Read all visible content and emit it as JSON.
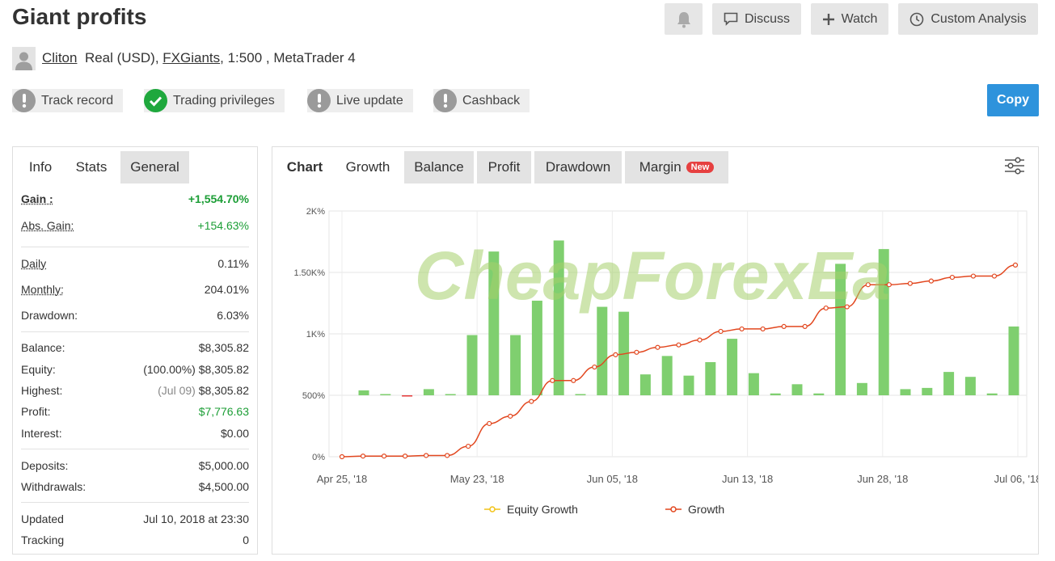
{
  "page": {
    "title": "Giant profits"
  },
  "header_buttons": {
    "discuss": "Discuss",
    "watch": "Watch",
    "custom_analysis": "Custom Analysis"
  },
  "owner": {
    "name": "Cliton",
    "account_type": "Real (USD),",
    "broker": "FXGiants",
    "details": ", 1:500 , MetaTrader 4"
  },
  "badges": [
    {
      "label": "Track record",
      "status": "grey"
    },
    {
      "label": "Trading privileges",
      "status": "green"
    },
    {
      "label": "Live update",
      "status": "grey"
    },
    {
      "label": "Cashback",
      "status": "grey"
    }
  ],
  "copy_label": "Copy",
  "left_tabs": [
    "Info",
    "Stats",
    "General"
  ],
  "stats": {
    "gain_label": "Gain :",
    "gain_value": "+1,554.70%",
    "abs_gain_label": "Abs. Gain:",
    "abs_gain_value": "+154.63%",
    "daily_label": "Daily",
    "daily_value": "0.11%",
    "monthly_label": "Monthly:",
    "monthly_value": "204.01%",
    "drawdown_label": "Drawdown:",
    "drawdown_value": "6.03%",
    "balance_label": "Balance:",
    "balance_value": "$8,305.82",
    "equity_label": "Equity:",
    "equity_pct": "(100.00%)",
    "equity_value": "$8,305.82",
    "highest_label": "Highest:",
    "highest_date": "(Jul 09)",
    "highest_value": "$8,305.82",
    "profit_label": "Profit:",
    "profit_value": "$7,776.63",
    "interest_label": "Interest:",
    "interest_value": "$0.00",
    "deposits_label": "Deposits:",
    "deposits_value": "$5,000.00",
    "withdrawals_label": "Withdrawals:",
    "withdrawals_value": "$4,500.00",
    "updated_label": "Updated",
    "updated_value": "Jul 10, 2018 at 23:30",
    "tracking_label": "Tracking",
    "tracking_value": "0"
  },
  "chart_tabs": {
    "chart": "Chart",
    "growth": "Growth",
    "balance": "Balance",
    "profit": "Profit",
    "drawdown": "Drawdown",
    "margin": "Margin",
    "new_tag": "New"
  },
  "watermark": "CheapForexEa",
  "colors": {
    "accent": "#2e93dc",
    "positive": "#1c9e36",
    "bar_positive": "#7fcf6f",
    "bar_negative": "#e53b3b",
    "growth_line": "#e2471f",
    "equity_line": "#f2c318"
  },
  "chart_data": {
    "type": "bar",
    "x_tick_labels": [
      "Apr 25, '18",
      "May 23, '18",
      "Jun 05, '18",
      "Jun 13, '18",
      "Jun 28, '18",
      "Jul 06, '18"
    ],
    "y_tick_labels": [
      "0%",
      "500%",
      "1K%",
      "1.50K%",
      "2K%"
    ],
    "ylim": [
      0,
      2000
    ],
    "grid": true,
    "legend_position": "bottom",
    "bar_values": [
      40,
      10,
      -10,
      50,
      10,
      490,
      1170,
      490,
      770,
      1260,
      10,
      720,
      680,
      170,
      320,
      160,
      270,
      460,
      180,
      15,
      90,
      15,
      1070,
      100,
      1190,
      50,
      60,
      190,
      150,
      15,
      560
    ],
    "series": [
      {
        "name": "Growth",
        "values": [
          0,
          5,
          5,
          5,
          10,
          10,
          85,
          270,
          330,
          450,
          620,
          620,
          730,
          830,
          850,
          890,
          910,
          950,
          1020,
          1040,
          1040,
          1060,
          1060,
          1210,
          1220,
          1400,
          1400,
          1410,
          1430,
          1460,
          1470,
          1470,
          1560
        ]
      },
      {
        "name": "Equity Growth",
        "values": []
      }
    ]
  }
}
